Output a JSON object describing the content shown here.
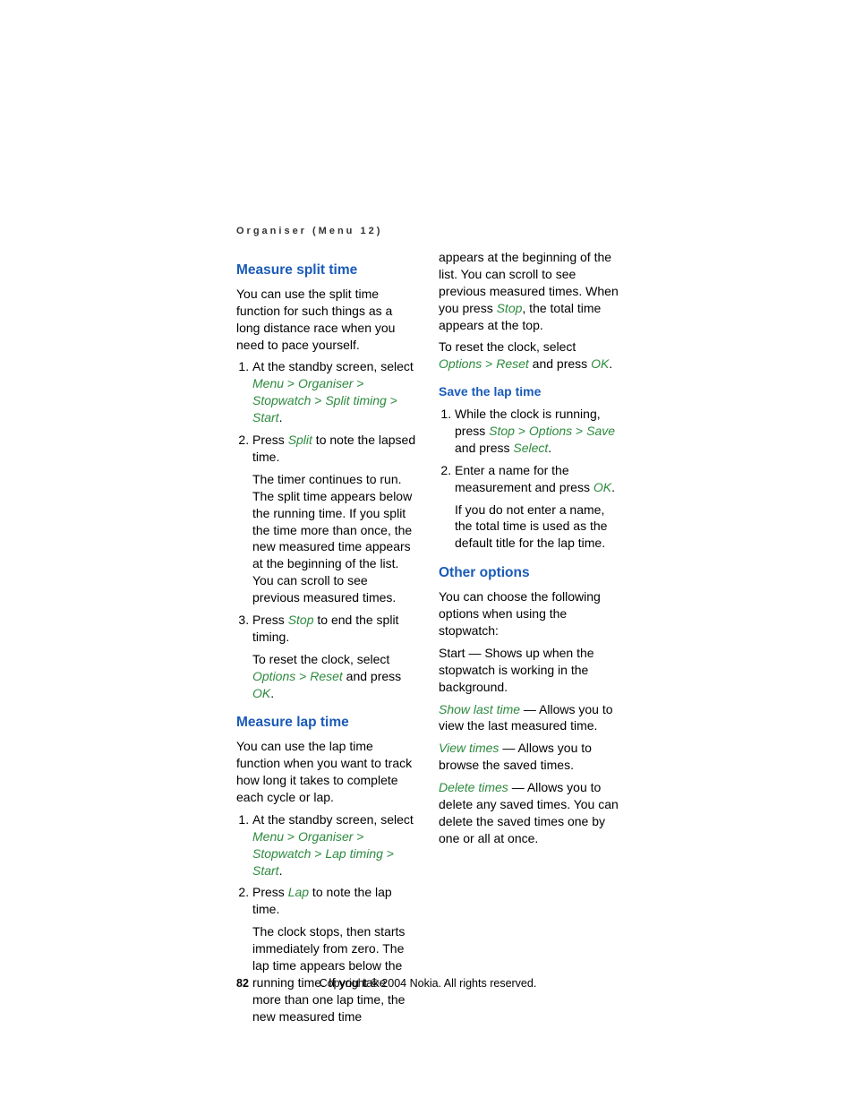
{
  "header": "Organiser (Menu 12)",
  "pageNumber": "82",
  "copyright": "Copyright © 2004 Nokia. All rights reserved.",
  "k": {
    "menu": "Menu",
    "organiser": "Organiser",
    "stopwatch": "Stopwatch",
    "splitTiming": "Split timing",
    "lapTiming": "Lap timing",
    "start": "Start",
    "split": "Split",
    "lap": "Lap",
    "stop": "Stop",
    "options": "Options",
    "reset": "Reset",
    "ok": "OK",
    "save": "Save",
    "select": "Select",
    "showLast": "Show last time",
    "viewTimes": "View times",
    "deleteTimes": "Delete times"
  },
  "s1": {
    "title": "Measure split time",
    "intro": "You can use the split time function for such things as a long distance race when you need to pace yourself.",
    "li1a": "At the standby screen, select ",
    "li1b": ".",
    "li2a": "Press ",
    "li2b": " to note the lapsed time.",
    "li2p": "The timer continues to run. The split time appears below the running time. If you split the time more than once, the new measured time appears at the beginning of the list. You can scroll to see previous measured times.",
    "li3a": "Press ",
    "li3b": " to end the split timing.",
    "li3p1": "To reset the clock, select ",
    "li3p2": " and press ",
    "li3p3": "."
  },
  "s2": {
    "title": "Measure lap time",
    "intro": "You can use the lap time function when you want to track how long it takes to complete each cycle or lap.",
    "li1a": "At the standby screen, select ",
    "li1b": ".",
    "li2a": "Press ",
    "li2b": " to note the lap time.",
    "li2p1": "The clock stops, then starts immediately from zero. The lap time appears below the running time. If you take more than one lap time, the new measured time ",
    "li2p2": "appears at the beginning of the list. You can scroll to see previous measured times. When you press ",
    "li2p3": ", the total time appears at the top.",
    "resetA": "To reset the clock, select ",
    "resetB": " and press ",
    "resetC": "."
  },
  "s3": {
    "title": "Save the lap time",
    "li1a": "While the clock is running, press ",
    "li1b": " and press ",
    "li1c": ".",
    "li2a": "Enter a name for the measurement and press ",
    "li2b": ".",
    "li2p": "If you do not enter a name, the total time is used as the default title for the lap time."
  },
  "s4": {
    "title": "Other options",
    "intro": "You can choose the following options when using the stopwatch:",
    "p1": "Start — Shows up when the stopwatch is working in the background.",
    "p2": " — Allows you to view the last measured time.",
    "p3": " — Allows you to browse the saved times.",
    "p4": " — Allows you to delete any saved times. You can delete the saved times one by one or all at once."
  }
}
